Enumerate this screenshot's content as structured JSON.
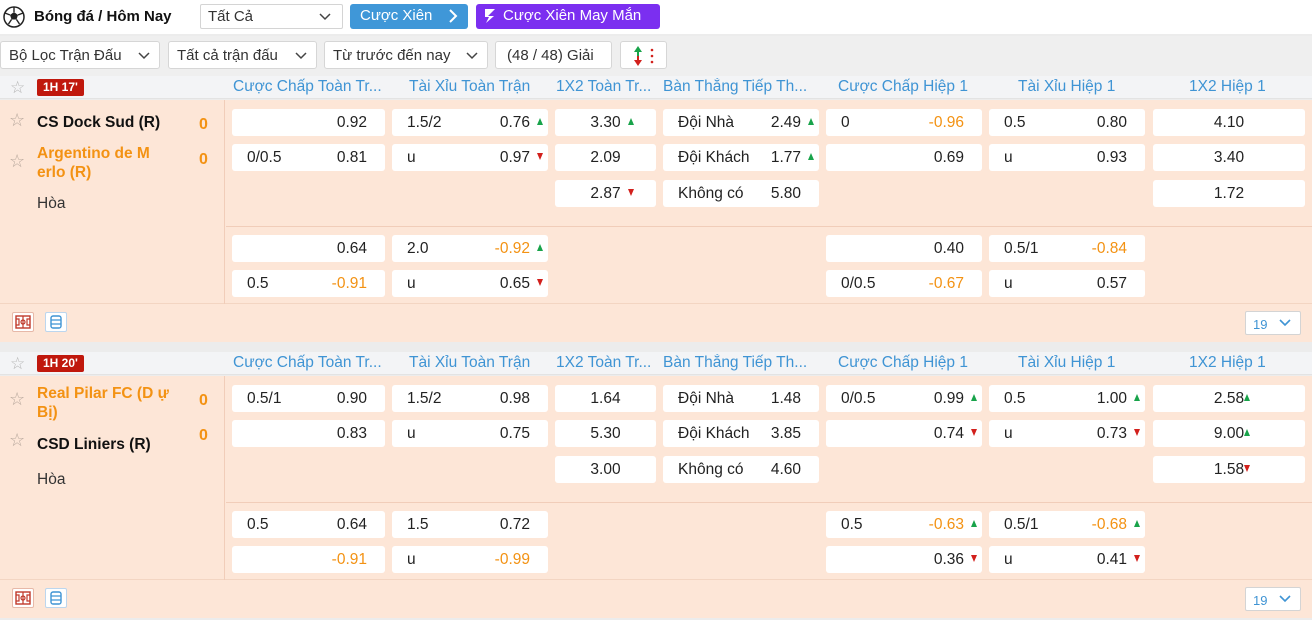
{
  "header": {
    "title": "Bóng đá / Hôm Nay",
    "filter_value": "Tất Cả",
    "btn_xien": "Cược Xiên",
    "btn_may_man": "Cược Xiên May Mắn"
  },
  "filters": {
    "loc": "Bộ Lọc Trận Đấu",
    "all_matches": "Tất cả trận đấu",
    "order": "Từ trước đến nay",
    "leagues": "(48 / 48) Giải"
  },
  "columns": [
    "Cược Chấp Toàn Tr...",
    "Tài Xỉu Toàn Trận",
    "1X2 Toàn Tr...",
    "Bàn Thắng Tiếp Th...",
    "Cược Chấp Hiệp 1",
    "Tài Xỉu Hiệp 1",
    "1X2 Hiệp 1"
  ],
  "labels": {
    "doi_nha": "Đội Nhà",
    "doi_khach": "Đội Khách",
    "khong_co": "Không có",
    "hoa": "Hòa",
    "u": "u"
  },
  "matches": [
    {
      "time": "1H 17'",
      "home": "CS Dock Sud (R)",
      "away": "Argentino de M erlo (R)",
      "home_score": "0",
      "away_score": "0",
      "page_count": "19",
      "m1": {
        "cc": [
          "",
          "0.92",
          "0/0.5",
          "0.81"
        ],
        "tx": [
          "1.5/2",
          "0.76",
          "0.97"
        ],
        "x12": [
          "3.30",
          "2.09",
          "2.87"
        ],
        "bt": [
          "2.49",
          "1.77",
          "5.80"
        ],
        "cch1": [
          "0",
          "-0.96",
          "",
          "0.69"
        ],
        "txh1": [
          "0.5",
          "0.80",
          "0.93"
        ],
        "x12h1": [
          "4.10",
          "3.40",
          "1.72"
        ]
      },
      "m2": {
        "cc": [
          "",
          "0.64",
          "0.5",
          "-0.91"
        ],
        "tx": [
          "2.0",
          "-0.92",
          "0.65"
        ],
        "cch1": [
          "",
          "0.40",
          "0/0.5",
          "-0.67"
        ],
        "txh1": [
          "0.5/1",
          "-0.84",
          "0.57"
        ]
      }
    },
    {
      "time": "1H 20'",
      "home": "Real Pilar FC (D ự Bị)",
      "away": "CSD Liniers (R)",
      "home_score": "0",
      "away_score": "0",
      "page_count": "19",
      "m1": {
        "cc": [
          "0.5/1",
          "0.90",
          "",
          "0.83"
        ],
        "tx": [
          "1.5/2",
          "0.98",
          "0.75"
        ],
        "x12": [
          "1.64",
          "5.30",
          "3.00"
        ],
        "bt": [
          "1.48",
          "3.85",
          "4.60"
        ],
        "cch1": [
          "0/0.5",
          "0.99",
          "",
          "0.74"
        ],
        "txh1": [
          "0.5",
          "1.00",
          "0.73"
        ],
        "x12h1": [
          "2.58",
          "9.00",
          "1.58"
        ]
      },
      "m2": {
        "cc": [
          "0.5",
          "0.64",
          "",
          "-0.91"
        ],
        "tx": [
          "1.5",
          "0.72",
          "-0.99"
        ],
        "cch1": [
          "0.5",
          "-0.63",
          "",
          "0.36"
        ],
        "txh1": [
          "0.5/1",
          "-0.68",
          "0.41"
        ]
      }
    }
  ],
  "colors": {
    "accent_blue": "#3f97d8",
    "purple": "#7b2ff0",
    "orange": "#f39213",
    "row_bg": "#fde6d7",
    "live_red": "#c0180d",
    "up_green": "#18a34a",
    "down_red": "#d2201c"
  }
}
